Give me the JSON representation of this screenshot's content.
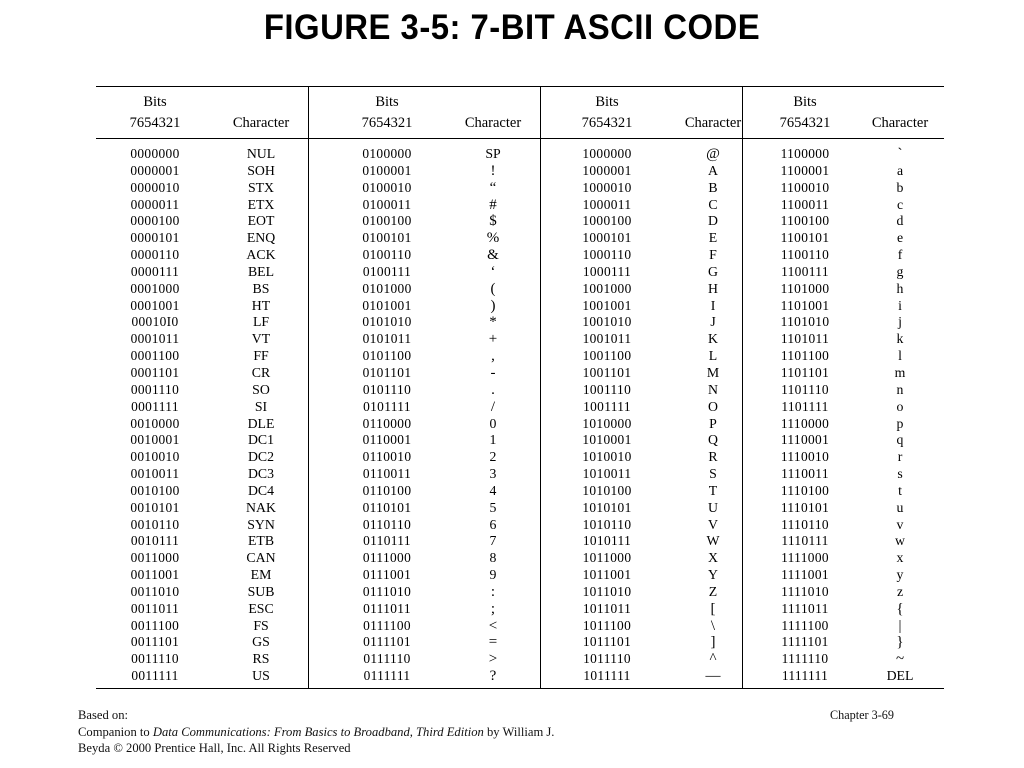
{
  "title": "FIGURE 3-5: 7-BIT ASCII CODE",
  "headers": {
    "bits_line1": "Bits",
    "bits_line2": "7654321",
    "character": "Character"
  },
  "footer": {
    "line1": "Based on:",
    "line2_prefix": "Companion to ",
    "line2_italic": "Data Communications: From Basics to Broadband, Third Edition",
    "line2_suffix": " by William J.",
    "line3": "Beyda © 2000 Prentice Hall, Inc. All Rights Reserved",
    "chapter": "Chapter 3-69"
  },
  "columns": [
    {
      "rows": [
        {
          "bits": "0000000",
          "char": "NUL"
        },
        {
          "bits": "0000001",
          "char": "SOH"
        },
        {
          "bits": "0000010",
          "char": "STX"
        },
        {
          "bits": "0000011",
          "char": "ETX"
        },
        {
          "bits": "0000100",
          "char": "EOT"
        },
        {
          "bits": "0000101",
          "char": "ENQ"
        },
        {
          "bits": "0000110",
          "char": "ACK"
        },
        {
          "bits": "0000111",
          "char": "BEL"
        },
        {
          "bits": "0001000",
          "char": "BS"
        },
        {
          "bits": "0001001",
          "char": "HT"
        },
        {
          "bits": "00010I0",
          "char": "LF"
        },
        {
          "bits": "0001011",
          "char": "VT"
        },
        {
          "bits": "0001100",
          "char": "FF"
        },
        {
          "bits": "0001101",
          "char": "CR"
        },
        {
          "bits": "0001110",
          "char": "SO"
        },
        {
          "bits": "0001111",
          "char": "SI"
        },
        {
          "bits": "0010000",
          "char": "DLE"
        },
        {
          "bits": "0010001",
          "char": "DC1"
        },
        {
          "bits": "0010010",
          "char": "DC2"
        },
        {
          "bits": "0010011",
          "char": "DC3"
        },
        {
          "bits": "0010100",
          "char": "DC4"
        },
        {
          "bits": "0010101",
          "char": "NAK"
        },
        {
          "bits": "0010110",
          "char": "SYN"
        },
        {
          "bits": "0010111",
          "char": "ETB"
        },
        {
          "bits": "0011000",
          "char": "CAN"
        },
        {
          "bits": "0011001",
          "char": "EM"
        },
        {
          "bits": "0011010",
          "char": "SUB"
        },
        {
          "bits": "0011011",
          "char": "ESC"
        },
        {
          "bits": "0011100",
          "char": "FS"
        },
        {
          "bits": "0011101",
          "char": "GS"
        },
        {
          "bits": "0011110",
          "char": "RS"
        },
        {
          "bits": "0011111",
          "char": "US"
        }
      ]
    },
    {
      "rows": [
        {
          "bits": "0100000",
          "char": "SP"
        },
        {
          "bits": "0100001",
          "char": "!",
          "sym": true
        },
        {
          "bits": "0100010",
          "char": "“",
          "sym": true
        },
        {
          "bits": "0100011",
          "char": "#",
          "sym": true
        },
        {
          "bits": "0100100",
          "char": "$",
          "sym": true
        },
        {
          "bits": "0100101",
          "char": "%",
          "sym": true
        },
        {
          "bits": "0100110",
          "char": "&",
          "sym": true
        },
        {
          "bits": "0100111",
          "char": "‘",
          "sym": true
        },
        {
          "bits": "0101000",
          "char": "(",
          "sym": true
        },
        {
          "bits": "0101001",
          "char": ")",
          "sym": true
        },
        {
          "bits": "0101010",
          "char": "*",
          "sym": true
        },
        {
          "bits": "0101011",
          "char": "+",
          "sym": true
        },
        {
          "bits": "0101100",
          "char": ",",
          "sym": true
        },
        {
          "bits": "0101101",
          "char": "-",
          "sym": true
        },
        {
          "bits": "0101110",
          "char": ".",
          "sym": true
        },
        {
          "bits": "0101111",
          "char": "/",
          "sym": true
        },
        {
          "bits": "0110000",
          "char": "0"
        },
        {
          "bits": "0110001",
          "char": "1"
        },
        {
          "bits": "0110010",
          "char": "2"
        },
        {
          "bits": "0110011",
          "char": "3"
        },
        {
          "bits": "0110100",
          "char": "4"
        },
        {
          "bits": "0110101",
          "char": "5"
        },
        {
          "bits": "0110110",
          "char": "6"
        },
        {
          "bits": "0110111",
          "char": "7"
        },
        {
          "bits": "0111000",
          "char": "8"
        },
        {
          "bits": "0111001",
          "char": "9"
        },
        {
          "bits": "0111010",
          "char": ":",
          "sym": true
        },
        {
          "bits": "0111011",
          "char": ";",
          "sym": true
        },
        {
          "bits": "0111100",
          "char": "<",
          "sym": true
        },
        {
          "bits": "0111101",
          "char": "=",
          "sym": true
        },
        {
          "bits": "0111110",
          "char": ">",
          "sym": true
        },
        {
          "bits": "0111111",
          "char": "?",
          "sym": true
        }
      ]
    },
    {
      "rows": [
        {
          "bits": "1000000",
          "char": "@",
          "sym": true
        },
        {
          "bits": "1000001",
          "char": "A"
        },
        {
          "bits": "1000010",
          "char": "B"
        },
        {
          "bits": "1000011",
          "char": "C"
        },
        {
          "bits": "1000100",
          "char": "D"
        },
        {
          "bits": "1000101",
          "char": "E"
        },
        {
          "bits": "1000110",
          "char": "F"
        },
        {
          "bits": "1000111",
          "char": "G"
        },
        {
          "bits": "1001000",
          "char": "H"
        },
        {
          "bits": "1001001",
          "char": "I"
        },
        {
          "bits": "1001010",
          "char": "J"
        },
        {
          "bits": "1001011",
          "char": "K"
        },
        {
          "bits": "1001100",
          "char": "L"
        },
        {
          "bits": "1001101",
          "char": "M"
        },
        {
          "bits": "1001110",
          "char": "N"
        },
        {
          "bits": "1001111",
          "char": "O"
        },
        {
          "bits": "1010000",
          "char": "P"
        },
        {
          "bits": "1010001",
          "char": "Q"
        },
        {
          "bits": "1010010",
          "char": "R"
        },
        {
          "bits": "1010011",
          "char": "S"
        },
        {
          "bits": "1010100",
          "char": "T"
        },
        {
          "bits": "1010101",
          "char": "U"
        },
        {
          "bits": "1010110",
          "char": "V"
        },
        {
          "bits": "1010111",
          "char": "W"
        },
        {
          "bits": "1011000",
          "char": "X"
        },
        {
          "bits": "1011001",
          "char": "Y"
        },
        {
          "bits": "1011010",
          "char": "Z"
        },
        {
          "bits": "1011011",
          "char": "[",
          "sym": true
        },
        {
          "bits": "1011100",
          "char": "\\",
          "sym": true
        },
        {
          "bits": "1011101",
          "char": "]",
          "sym": true
        },
        {
          "bits": "1011110",
          "char": "^",
          "sym": true
        },
        {
          "bits": "1011111",
          "char": "—",
          "sym": true
        }
      ]
    },
    {
      "rows": [
        {
          "bits": "1100000",
          "char": "`",
          "sym": true
        },
        {
          "bits": "1100001",
          "char": "a"
        },
        {
          "bits": "1100010",
          "char": "b"
        },
        {
          "bits": "1100011",
          "char": "c"
        },
        {
          "bits": "1100100",
          "char": "d"
        },
        {
          "bits": "1100101",
          "char": "e"
        },
        {
          "bits": "1100110",
          "char": "f"
        },
        {
          "bits": "1100111",
          "char": "g"
        },
        {
          "bits": "1101000",
          "char": "h"
        },
        {
          "bits": "1101001",
          "char": "i"
        },
        {
          "bits": "1101010",
          "char": "j"
        },
        {
          "bits": "1101011",
          "char": "k"
        },
        {
          "bits": "1101100",
          "char": "l"
        },
        {
          "bits": "1101101",
          "char": "m"
        },
        {
          "bits": "1101110",
          "char": "n"
        },
        {
          "bits": "1101111",
          "char": "o"
        },
        {
          "bits": "1110000",
          "char": "p"
        },
        {
          "bits": "1110001",
          "char": "q"
        },
        {
          "bits": "1110010",
          "char": "r"
        },
        {
          "bits": "1110011",
          "char": "s"
        },
        {
          "bits": "1110100",
          "char": "t"
        },
        {
          "bits": "1110101",
          "char": "u"
        },
        {
          "bits": "1110110",
          "char": "v"
        },
        {
          "bits": "1110111",
          "char": "w"
        },
        {
          "bits": "1111000",
          "char": "x"
        },
        {
          "bits": "1111001",
          "char": "y"
        },
        {
          "bits": "1111010",
          "char": "z"
        },
        {
          "bits": "1111011",
          "char": "{",
          "sym": true
        },
        {
          "bits": "1111100",
          "char": "|",
          "sym": true
        },
        {
          "bits": "1111101",
          "char": "}",
          "sym": true
        },
        {
          "bits": "1111110",
          "char": "~",
          "sym": true
        },
        {
          "bits": "1111111",
          "char": "DEL"
        }
      ]
    }
  ]
}
